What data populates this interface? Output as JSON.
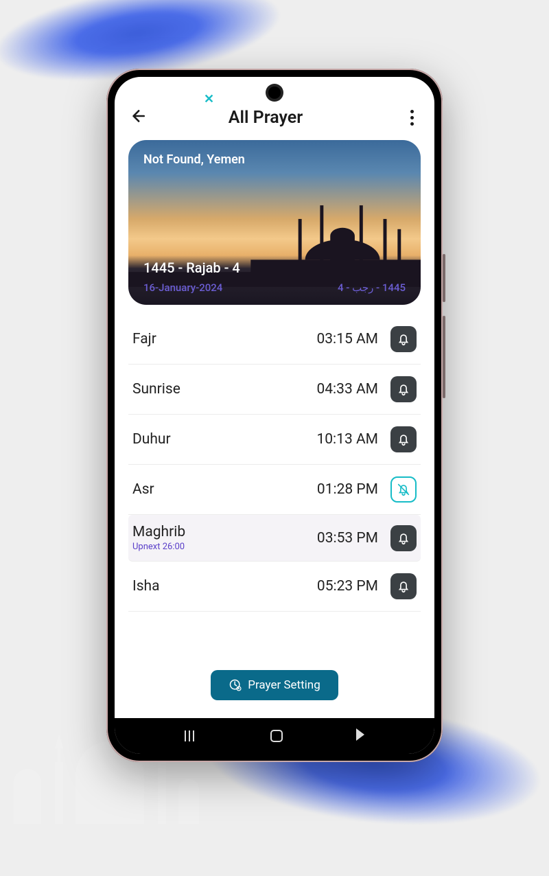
{
  "header": {
    "title": "All Prayer",
    "close_x": "✕"
  },
  "hero": {
    "location": "Not Found, Yemen",
    "hijri": "1445 - Rajab - 4",
    "gregorian": "16-January-2024",
    "arabic": "1445 - رجب - 4"
  },
  "prayers": [
    {
      "name": "Fajr",
      "time": "03:15 AM",
      "bell": "on",
      "sub": ""
    },
    {
      "name": "Sunrise",
      "time": "04:33 AM",
      "bell": "on",
      "sub": ""
    },
    {
      "name": "Duhur",
      "time": "10:13 AM",
      "bell": "on",
      "sub": ""
    },
    {
      "name": "Asr",
      "time": "01:28 PM",
      "bell": "off",
      "sub": ""
    },
    {
      "name": "Maghrib",
      "time": "03:53 PM",
      "bell": "on",
      "sub": "Upnext 26:00",
      "highlight": true
    },
    {
      "name": "Isha",
      "time": "05:23 PM",
      "bell": "on",
      "sub": ""
    }
  ],
  "footer": {
    "setting_label": "Prayer Setting"
  },
  "colors": {
    "accent": "#0a6a8a",
    "teal": "#17bcc7",
    "purple": "#5a3fc9"
  }
}
